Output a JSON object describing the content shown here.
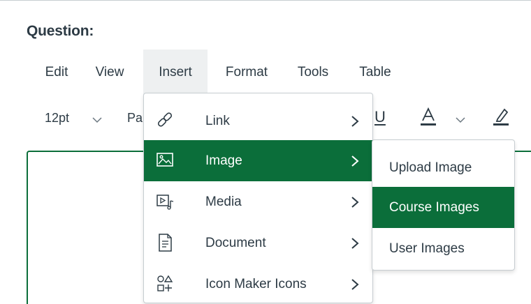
{
  "question_label": "Question:",
  "menubar": {
    "items": [
      {
        "label": "Edit"
      },
      {
        "label": "View"
      },
      {
        "label": "Insert"
      },
      {
        "label": "Format"
      },
      {
        "label": "Tools"
      },
      {
        "label": "Table"
      }
    ],
    "active": "Insert"
  },
  "toolbar": {
    "font_size": "12pt",
    "paragraph_partial": "Pa",
    "underline_glyph": "U",
    "icons": [
      "chevron-down-icon",
      "underline-icon",
      "font-color-icon",
      "highlight-icon"
    ]
  },
  "insert_menu": {
    "items": [
      {
        "label": "Link",
        "icon": "link-icon",
        "has_submenu": true
      },
      {
        "label": "Image",
        "icon": "image-icon",
        "has_submenu": true,
        "selected": true
      },
      {
        "label": "Media",
        "icon": "media-icon",
        "has_submenu": true
      },
      {
        "label": "Document",
        "icon": "document-icon",
        "has_submenu": true
      },
      {
        "label": "Icon Maker Icons",
        "icon": "icon-maker-icon",
        "has_submenu": true
      }
    ]
  },
  "image_submenu": {
    "items": [
      {
        "label": "Upload Image"
      },
      {
        "label": "Course Images",
        "selected": true
      },
      {
        "label": "User Images"
      }
    ]
  },
  "colors": {
    "accent_green": "#0b6e3a",
    "text": "#2d3b45",
    "menubar_active_bg": "#eef0f1",
    "border": "#c7cdd1"
  }
}
